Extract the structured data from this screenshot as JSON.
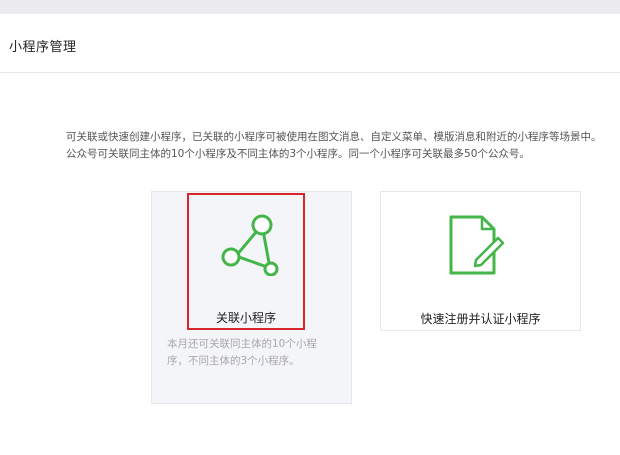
{
  "header": {
    "title": "小程序管理"
  },
  "description": {
    "line1": "可关联或快速创建小程序，已关联的小程序可被使用在图文消息、自定义菜单、模版消息和附近的小程序等场景中。",
    "line2": "公众号可关联同主体的10个小程序及不同主体的3个小程序。同一个小程序可关联最多50个公众号。"
  },
  "cards": {
    "link": {
      "label": "关联小程序",
      "icon": "network-link-icon",
      "note_line1": "本月还可关联同主体的10个小程",
      "note_line2": "序，不同主体的3个小程序。"
    },
    "register": {
      "label": "快速注册并认证小程序",
      "icon": "document-edit-icon"
    }
  },
  "colors": {
    "accent_green": "#44b549",
    "highlight_red": "#d8262d",
    "card_bg": "#f4f5f9"
  }
}
